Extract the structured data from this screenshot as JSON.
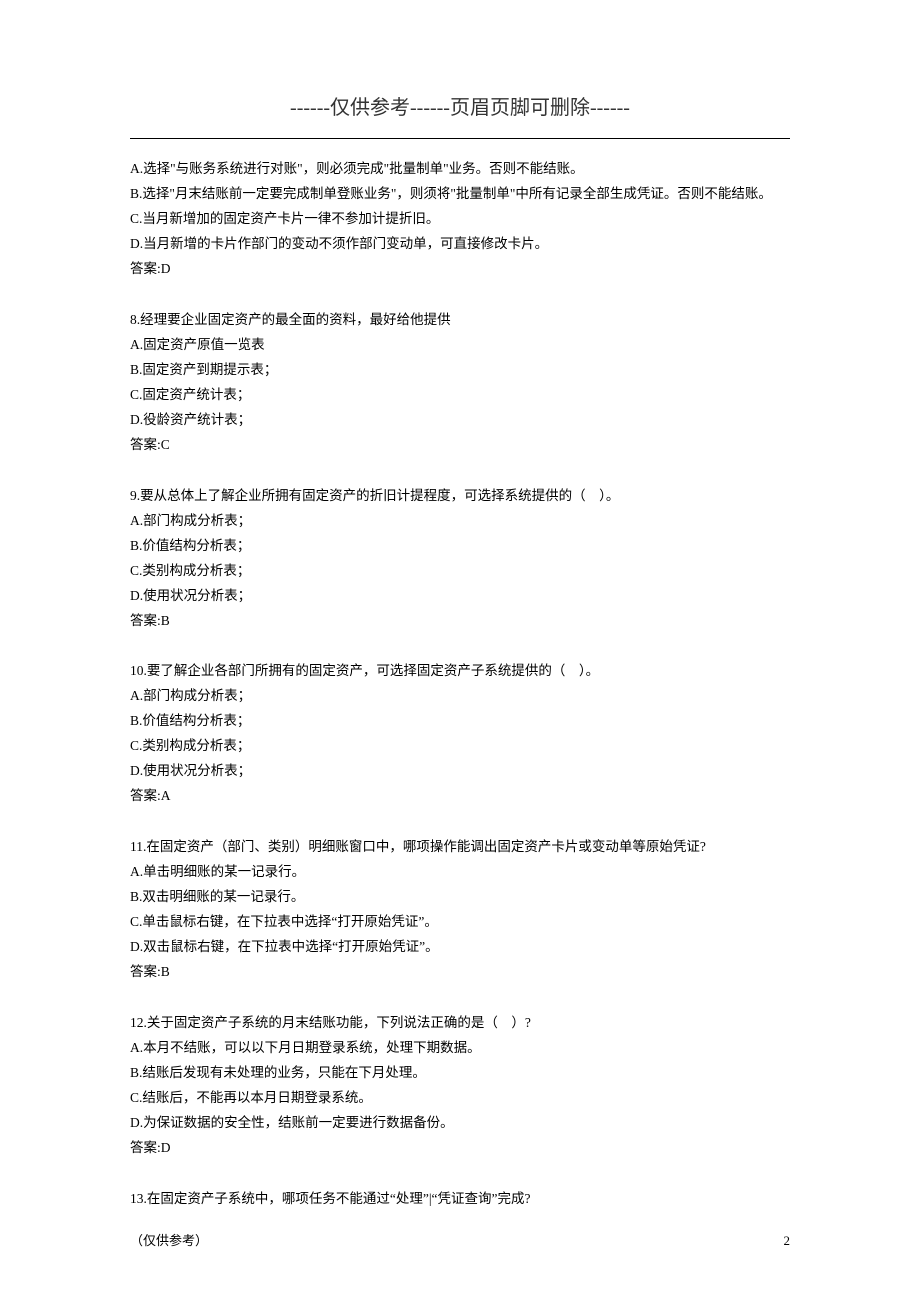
{
  "header": {
    "text": "------仅供参考------页眉页脚可删除------"
  },
  "content": {
    "intro_lines": [
      "A.选择\"与账务系统进行对账\"，则必须完成\"批量制单\"业务。否则不能结账。",
      "B.选择\"月末结账前一定要完成制单登账业务\"，则须将\"批量制单\"中所有记录全部生成凭证。否则不能结账。",
      "C.当月新增加的固定资产卡片一律不参加计提折旧。",
      "D.当月新增的卡片作部门的变动不须作部门变动单，可直接修改卡片。",
      "答案:D"
    ],
    "questions": [
      {
        "stem": "8.经理要企业固定资产的最全面的资料，最好给他提供",
        "options": [
          "A.固定资产原值一览表",
          "B.固定资产到期提示表；",
          "C.固定资产统计表；",
          "D.役龄资产统计表；"
        ],
        "answer": "答案:C"
      },
      {
        "stem": "9.要从总体上了解企业所拥有固定资产的折旧计提程度，可选择系统提供的（　）。",
        "options": [
          "A.部门构成分析表；",
          "B.价值结构分析表；",
          "C.类别构成分析表；",
          "D.使用状况分析表；"
        ],
        "answer": "答案:B"
      },
      {
        "stem": "10.要了解企业各部门所拥有的固定资产，可选择固定资产子系统提供的（　）。",
        "options": [
          "A.部门构成分析表；",
          "B.价值结构分析表；",
          "C.类别构成分析表；",
          "D.使用状况分析表；"
        ],
        "answer": "答案:A"
      },
      {
        "stem": "11.在固定资产（部门、类别）明细账窗口中，哪项操作能调出固定资产卡片或变动单等原始凭证?",
        "options": [
          "A.单击明细账的某一记录行。",
          "B.双击明细账的某一记录行。",
          "C.单击鼠标右键，在下拉表中选择“打开原始凭证”。",
          "D.双击鼠标右键，在下拉表中选择“打开原始凭证”。"
        ],
        "answer": "答案:B"
      },
      {
        "stem": "12.关于固定资产子系统的月末结账功能，下列说法正确的是（　）?",
        "options": [
          "A.本月不结账，可以以下月日期登录系统，处理下期数据。",
          "B.结账后发现有未处理的业务，只能在下月处理。",
          "C.结账后，不能再以本月日期登录系统。",
          "D.为保证数据的安全性，结账前一定要进行数据备份。"
        ],
        "answer": "答案:D"
      },
      {
        "stem": "13.在固定资产子系统中，哪项任务不能通过“处理”|“凭证查询”完成?",
        "options": [],
        "answer": ""
      }
    ]
  },
  "footer": {
    "left": "（仅供参考）",
    "right": "2"
  }
}
